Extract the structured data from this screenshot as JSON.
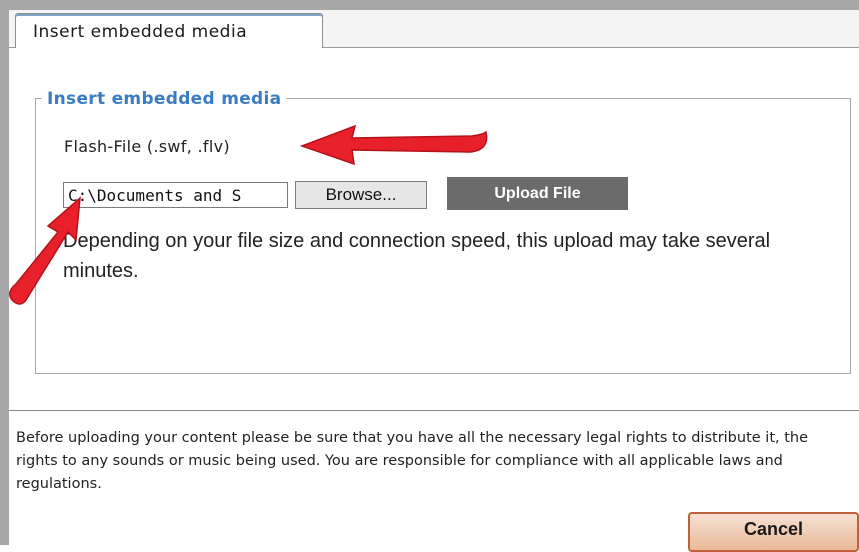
{
  "tab": {
    "label": "Insert embedded media"
  },
  "fieldset": {
    "legend": "Insert embedded media"
  },
  "flash": {
    "label": "Flash-File (.swf, .flv)"
  },
  "file_input": {
    "value": "C:\\Documents and S"
  },
  "buttons": {
    "browse": "Browse...",
    "upload": "Upload File",
    "cancel": "Cancel"
  },
  "hint": "Depending on your file size and connection speed, this upload may take several minutes.",
  "legal": "Before uploading your content please be sure that you have all the necessary legal rights to distribute it, the rights to any sounds or music being used. You are responsible for compliance with all applicable laws and regulations.",
  "icons": {
    "annotation_arrow_1": "arrow-left-icon",
    "annotation_arrow_2": "arrow-up-right-icon"
  },
  "colors": {
    "legend": "#3a7cc2",
    "upload_bg": "#6b6b6b",
    "arrow": "#e8202a",
    "cancel_border": "#c0603a"
  }
}
